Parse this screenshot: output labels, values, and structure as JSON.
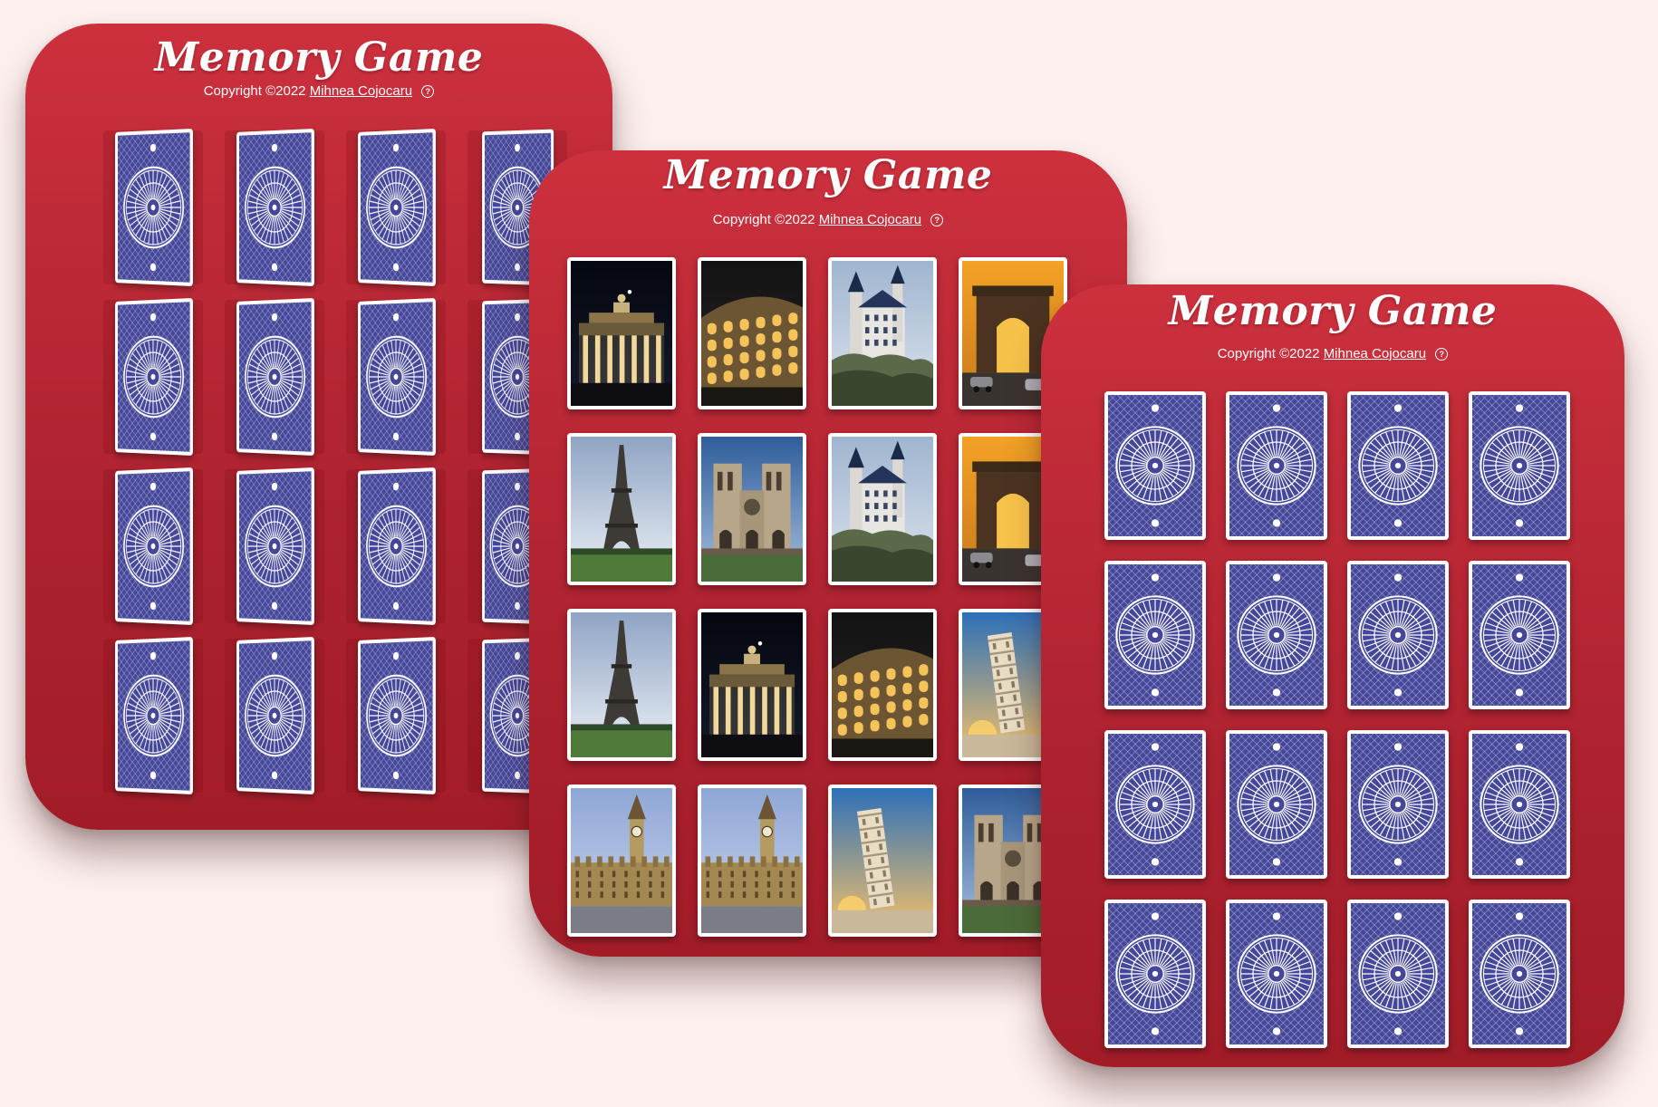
{
  "panels": [
    {
      "id": "left",
      "state": "flipping",
      "title": "Memory Game",
      "copyright_prefix": "Copyright ©2022",
      "author": "Mihnea Cojocaru",
      "help_glyph": "?",
      "cards": [
        "back",
        "back",
        "back",
        "back",
        "back",
        "back",
        "back",
        "back",
        "back",
        "back",
        "back",
        "back",
        "back",
        "back",
        "back",
        "back"
      ]
    },
    {
      "id": "middle",
      "state": "revealed",
      "title": "Memory Game",
      "copyright_prefix": "Copyright ©2022",
      "author": "Mihnea Cojocaru",
      "help_glyph": "?",
      "cards": [
        "brandenburg-gate",
        "colosseum",
        "neuschwanstein-castle",
        "arc-de-triomphe",
        "eiffel-tower",
        "notre-dame",
        "neuschwanstein-castle",
        "arc-de-triomphe",
        "eiffel-tower",
        "brandenburg-gate",
        "colosseum",
        "leaning-tower-of-pisa",
        "big-ben",
        "big-ben",
        "leaning-tower-of-pisa",
        "notre-dame"
      ]
    },
    {
      "id": "right",
      "state": "face-down",
      "title": "Memory Game",
      "copyright_prefix": "Copyright ©2022",
      "author": "Mihnea Cojocaru",
      "help_glyph": "?",
      "cards": [
        "back",
        "back",
        "back",
        "back",
        "back",
        "back",
        "back",
        "back",
        "back",
        "back",
        "back",
        "back",
        "back",
        "back",
        "back",
        "back"
      ]
    }
  ],
  "colors": {
    "background": "#fcefed",
    "panel": "#b82634",
    "card_back": "#45479a",
    "card_border": "#ffffff"
  }
}
